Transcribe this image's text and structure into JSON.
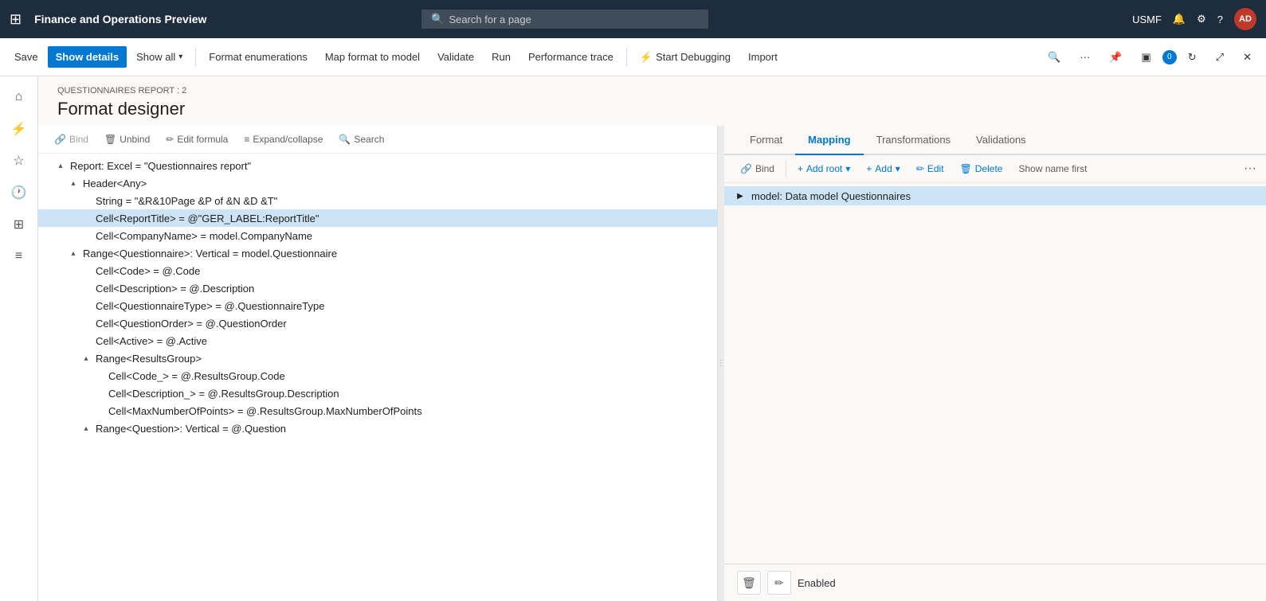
{
  "topNav": {
    "appTitle": "Finance and Operations Preview",
    "searchPlaceholder": "Search for a page",
    "user": "USMF",
    "avatar": "AD"
  },
  "toolbar": {
    "save": "Save",
    "showDetails": "Show details",
    "showAll": "Show all",
    "formatEnumerations": "Format enumerations",
    "mapFormatToModel": "Map format to model",
    "validate": "Validate",
    "run": "Run",
    "performanceTrace": "Performance trace",
    "startDebugging": "Start Debugging",
    "import": "Import"
  },
  "page": {
    "breadcrumb": "QUESTIONNAIRES REPORT : 2",
    "title": "Format designer"
  },
  "leftPanelToolbar": {
    "bind": "Bind",
    "unbind": "Unbind",
    "editFormula": "Edit formula",
    "expandCollapse": "Expand/collapse",
    "search": "Search"
  },
  "tree": {
    "items": [
      {
        "id": 1,
        "indent": 1,
        "toggle": "▴",
        "text": "Report: Excel = \"Questionnaires report\"",
        "selected": false
      },
      {
        "id": 2,
        "indent": 2,
        "toggle": "▴",
        "text": "Header<Any>",
        "selected": false
      },
      {
        "id": 3,
        "indent": 3,
        "toggle": "",
        "text": "String = \"&R&10Page &P of &N &D &T\"",
        "selected": false
      },
      {
        "id": 4,
        "indent": 3,
        "toggle": "",
        "text": "Cell<ReportTitle> = @\"GER_LABEL:ReportTitle\"",
        "selected": true
      },
      {
        "id": 5,
        "indent": 3,
        "toggle": "",
        "text": "Cell<CompanyName> = model.CompanyName",
        "selected": false
      },
      {
        "id": 6,
        "indent": 2,
        "toggle": "▴",
        "text": "Range<Questionnaire>: Vertical = model.Questionnaire",
        "selected": false
      },
      {
        "id": 7,
        "indent": 3,
        "toggle": "",
        "text": "Cell<Code> = @.Code",
        "selected": false
      },
      {
        "id": 8,
        "indent": 3,
        "toggle": "",
        "text": "Cell<Description> = @.Description",
        "selected": false
      },
      {
        "id": 9,
        "indent": 3,
        "toggle": "",
        "text": "Cell<QuestionnaireType> = @.QuestionnaireType",
        "selected": false
      },
      {
        "id": 10,
        "indent": 3,
        "toggle": "",
        "text": "Cell<QuestionOrder> = @.QuestionOrder",
        "selected": false
      },
      {
        "id": 11,
        "indent": 3,
        "toggle": "",
        "text": "Cell<Active> = @.Active",
        "selected": false
      },
      {
        "id": 12,
        "indent": 3,
        "toggle": "▴",
        "text": "Range<ResultsGroup>",
        "selected": false
      },
      {
        "id": 13,
        "indent": 4,
        "toggle": "",
        "text": "Cell<Code_> = @.ResultsGroup.Code",
        "selected": false
      },
      {
        "id": 14,
        "indent": 4,
        "toggle": "",
        "text": "Cell<Description_> = @.ResultsGroup.Description",
        "selected": false
      },
      {
        "id": 15,
        "indent": 4,
        "toggle": "",
        "text": "Cell<MaxNumberOfPoints> = @.ResultsGroup.MaxNumberOfPoints",
        "selected": false
      },
      {
        "id": 16,
        "indent": 3,
        "toggle": "▴",
        "text": "Range<Question>: Vertical = @.Question",
        "selected": false
      }
    ]
  },
  "rightPanel": {
    "tabs": [
      {
        "id": "format",
        "label": "Format",
        "active": false
      },
      {
        "id": "mapping",
        "label": "Mapping",
        "active": true
      },
      {
        "id": "transformations",
        "label": "Transformations",
        "active": false
      },
      {
        "id": "validations",
        "label": "Validations",
        "active": false
      }
    ],
    "mappingToolbar": {
      "bind": "Bind",
      "addRoot": "Add root",
      "add": "Add",
      "edit": "Edit",
      "delete": "Delete",
      "showNameFirst": "Show name first"
    },
    "mappingTree": [
      {
        "id": 1,
        "indent": 0,
        "toggle": "▶",
        "text": "model: Data model Questionnaires",
        "selected": true
      }
    ],
    "bottomStrip": {
      "status": "Enabled",
      "deleteIcon": "🗑",
      "editIcon": "✏"
    }
  }
}
